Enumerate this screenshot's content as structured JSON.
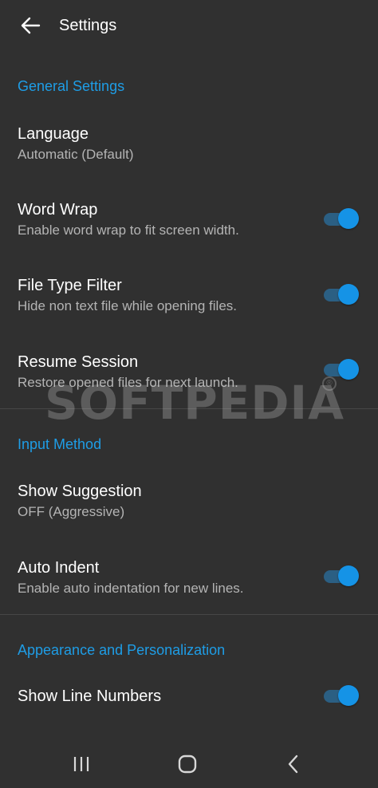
{
  "appbar": {
    "title": "Settings",
    "back_icon": "arrow-left-icon"
  },
  "sections": {
    "general": {
      "header": "General Settings",
      "language": {
        "title": "Language",
        "summary": "Automatic (Default)"
      },
      "word_wrap": {
        "title": "Word Wrap",
        "summary": "Enable word wrap to fit screen width.",
        "enabled": true
      },
      "file_type_filter": {
        "title": "File Type Filter",
        "summary": "Hide non text file while opening files.",
        "enabled": true
      },
      "resume_session": {
        "title": "Resume Session",
        "summary": "Restore opened files for next launch.",
        "enabled": true
      }
    },
    "input_method": {
      "header": "Input Method",
      "show_suggestion": {
        "title": "Show Suggestion",
        "summary": "OFF (Aggressive)"
      },
      "auto_indent": {
        "title": "Auto Indent",
        "summary": "Enable auto indentation for new lines.",
        "enabled": true
      }
    },
    "appearance": {
      "header": "Appearance and Personalization",
      "show_line_numbers": {
        "title": "Show Line Numbers",
        "enabled": true
      }
    }
  },
  "watermark": {
    "text": "SOFTPEDIA",
    "mark": "®"
  },
  "navbar": {
    "recents_icon": "recents-icon",
    "home_icon": "home-icon",
    "back_icon": "chevron-left-icon"
  },
  "colors": {
    "background": "#303030",
    "accent": "#1e9de6",
    "switch_thumb": "#1593e6",
    "switch_track": "#2b5f83",
    "text_primary": "#ffffff",
    "text_secondary": "#b4b4b4"
  }
}
